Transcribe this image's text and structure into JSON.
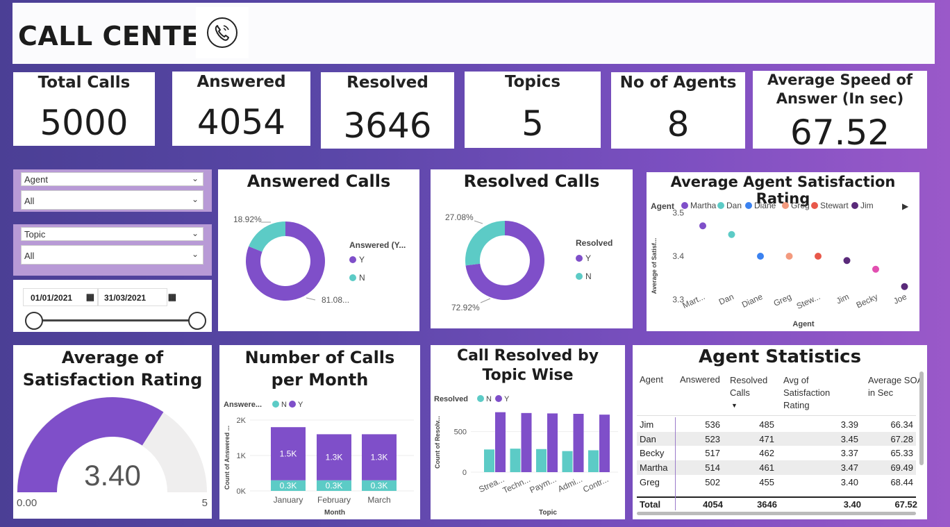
{
  "header": {
    "title": "CALL CENTER",
    "icon": "phone-icon"
  },
  "kpis": [
    {
      "label": "Total Calls",
      "value": "5000"
    },
    {
      "label": "Answered",
      "value": "4054"
    },
    {
      "label": "Resolved",
      "value": "3646"
    },
    {
      "label": "Topics",
      "value": "5"
    },
    {
      "label": "No of Agents",
      "value": "8"
    },
    {
      "label": "Average Speed of Answer (In sec)",
      "value": "67.52"
    }
  ],
  "slicers": {
    "agent": {
      "label": "Agent",
      "value": "All"
    },
    "topic": {
      "label": "Topic",
      "value": "All"
    },
    "date": {
      "start": "01/01/2021",
      "end": "31/03/2021"
    }
  },
  "answered_calls": {
    "title": "Answered Calls",
    "legend_title": "Answered (Y...",
    "legend": [
      "Y",
      "N"
    ],
    "label_y": "81.08...",
    "label_n": "18.92%"
  },
  "resolved_calls": {
    "title": "Resolved Calls",
    "legend_title": "Resolved",
    "legend": [
      "Y",
      "N"
    ],
    "label_y": "72.92%",
    "label_n": "27.08%"
  },
  "satisfaction_chart": {
    "title": "Average Agent Satisfaction Rating",
    "legend_title": "Agent",
    "legend": [
      "Martha",
      "Dan",
      "Diane",
      "Greg",
      "Stewart",
      "Jim"
    ],
    "ylabel": "Average of Satisf...",
    "xlabel": "Agent",
    "yticks": [
      "3.5",
      "3.4",
      "3.3"
    ],
    "xticks": [
      "Mart...",
      "Dan",
      "Diane",
      "Greg",
      "Stew...",
      "Jim",
      "Becky",
      "Joe"
    ]
  },
  "gauge": {
    "title": "Average of Satisfaction Rating",
    "value": "3.40",
    "min": "0.00",
    "max": "5"
  },
  "calls_per_month": {
    "title": "Number of Calls per Month",
    "legend_title": "Answere...",
    "legend": [
      "N",
      "Y"
    ],
    "ylabel": "Count of Answered ...",
    "xlabel": "Month",
    "yticks": [
      "2K",
      "1K",
      "0K"
    ],
    "y_labels": [
      "1.5K",
      "1.3K",
      "1.3K"
    ],
    "n_labels": [
      "0.3K",
      "0.3K",
      "0.3K"
    ]
  },
  "resolved_by_topic": {
    "title": "Call Resolved by Topic Wise",
    "legend_title": "Resolved",
    "legend": [
      "N",
      "Y"
    ],
    "ylabel": "Count of Resolv...",
    "xlabel": "Topic",
    "yticks": [
      "500",
      "0"
    ]
  },
  "agent_stats": {
    "title": "Agent Statistics",
    "headers": [
      "Agent",
      "Answered",
      "Resolved Calls",
      "Avg of Satisfaction Rating",
      "Average SOA in Sec"
    ],
    "rows": [
      [
        "Jim",
        "536",
        "485",
        "3.39",
        "66.34"
      ],
      [
        "Dan",
        "523",
        "471",
        "3.45",
        "67.28"
      ],
      [
        "Becky",
        "517",
        "462",
        "3.37",
        "65.33"
      ],
      [
        "Martha",
        "514",
        "461",
        "3.47",
        "69.49"
      ],
      [
        "Greg",
        "502",
        "455",
        "3.40",
        "68.44"
      ]
    ],
    "total": [
      "Total",
      "4054",
      "3646",
      "3.40",
      "67.52"
    ]
  },
  "colors": {
    "purple": "#7f4fc9",
    "teal": "#5ccbc6",
    "blue": "#3b82f0",
    "salmon": "#f39a7e",
    "red": "#e8584a",
    "dark_purple": "#5a2a7a",
    "pink": "#e24fb0"
  },
  "chart_data": [
    {
      "type": "pie",
      "title": "Answered Calls",
      "categories": [
        "Y",
        "N"
      ],
      "values": [
        81.08,
        18.92
      ]
    },
    {
      "type": "pie",
      "title": "Resolved Calls",
      "categories": [
        "Y",
        "N"
      ],
      "values": [
        72.92,
        27.08
      ]
    },
    {
      "type": "scatter",
      "title": "Average Agent Satisfaction Rating",
      "xlabel": "Agent",
      "categories": [
        "Martha",
        "Dan",
        "Diane",
        "Greg",
        "Stewart",
        "Jim",
        "Becky",
        "Joe"
      ],
      "values": [
        3.47,
        3.45,
        3.4,
        3.4,
        3.4,
        3.39,
        3.37,
        3.33
      ],
      "ylim": [
        3.28,
        3.52
      ]
    },
    {
      "type": "bar",
      "title": "Number of Calls per Month",
      "xlabel": "Month",
      "categories": [
        "January",
        "February",
        "March"
      ],
      "series": [
        {
          "name": "N",
          "values": [
            300,
            300,
            300
          ]
        },
        {
          "name": "Y",
          "values": [
            1500,
            1300,
            1300
          ]
        }
      ],
      "ylim": [
        0,
        2000
      ]
    },
    {
      "type": "bar",
      "title": "Call Resolved by Topic Wise",
      "xlabel": "Topic",
      "categories": [
        "Strea...",
        "Techn...",
        "Paym...",
        "Admi...",
        "Contr..."
      ],
      "series": [
        {
          "name": "N",
          "values": [
            280,
            290,
            285,
            260,
            270
          ]
        },
        {
          "name": "Y",
          "values": [
            740,
            730,
            725,
            720,
            710
          ]
        }
      ],
      "ylim": [
        0,
        900
      ]
    }
  ]
}
